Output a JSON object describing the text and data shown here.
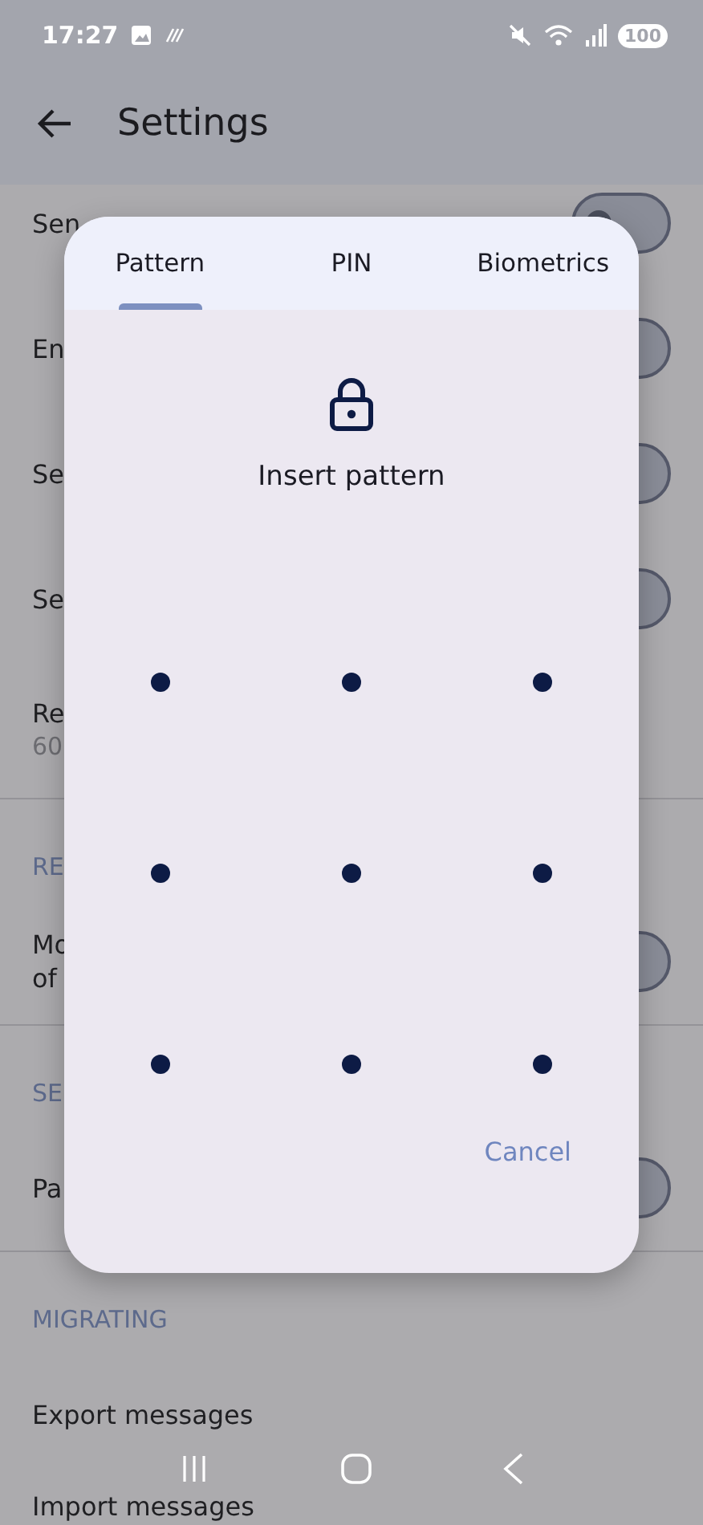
{
  "status_bar": {
    "time": "17:27",
    "battery": "100"
  },
  "app_bar": {
    "title": "Settings"
  },
  "settings": [
    {
      "kind": "toggle",
      "title": "Sen",
      "on": false
    },
    {
      "kind": "toggle",
      "title": "En",
      "on": false
    },
    {
      "kind": "toggle",
      "title": "Se",
      "on": false
    },
    {
      "kind": "toggle",
      "title": "Se",
      "on": false
    },
    {
      "kind": "detail",
      "title": "Re",
      "subtitle": "60"
    },
    {
      "kind": "header",
      "title": "RE"
    },
    {
      "kind": "toggle",
      "title": "Mo",
      "title_line2": "of",
      "on": false
    },
    {
      "kind": "header",
      "title": "SE"
    },
    {
      "kind": "toggle",
      "title": "Pa",
      "on": false
    },
    {
      "kind": "header",
      "title": "MIGRATING"
    },
    {
      "kind": "link",
      "title": "Export messages"
    },
    {
      "kind": "last",
      "title": "Import messages"
    }
  ],
  "dialog": {
    "tabs": [
      {
        "label": "Pattern",
        "selected": true
      },
      {
        "label": "PIN",
        "selected": false
      },
      {
        "label": "Biometrics",
        "selected": false
      }
    ],
    "prompt": "Insert pattern",
    "cancel": "Cancel"
  }
}
